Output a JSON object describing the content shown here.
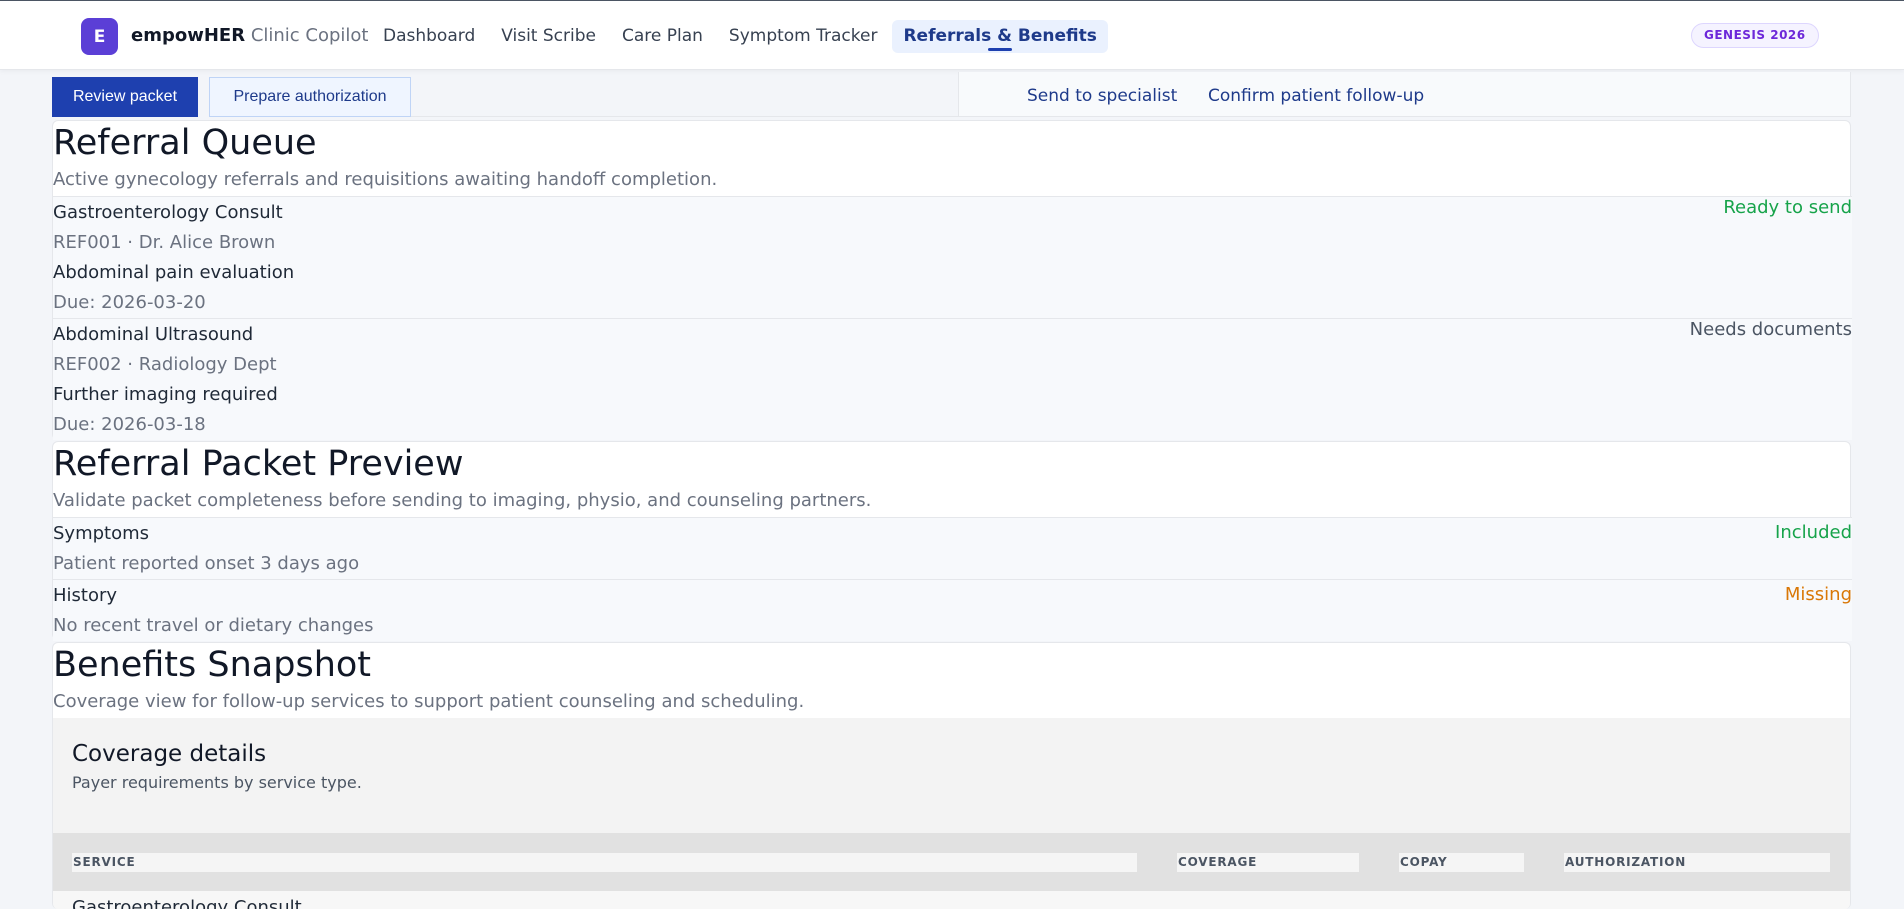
{
  "app": {
    "logo_letter": "E",
    "brand_bold": "empowHER",
    "brand_rest": "Clinic Copilot",
    "badge": "GENESIS 2026"
  },
  "nav": {
    "items": [
      {
        "label": "Dashboard",
        "active": false
      },
      {
        "label": "Visit Scribe",
        "active": false
      },
      {
        "label": "Care Plan",
        "active": false
      },
      {
        "label": "Symptom Tracker",
        "active": false
      },
      {
        "label": "Referrals & Benefits",
        "active": true
      }
    ]
  },
  "actions": {
    "review_packet": "Review packet",
    "prepare_authorization": "Prepare authorization",
    "send_to_specialist": "Send to specialist",
    "confirm_follow_up": "Confirm patient follow-up"
  },
  "referral_queue": {
    "title": "Referral Queue",
    "subtitle": "Active gynecology referrals and requisitions awaiting handoff completion.",
    "items": [
      {
        "name": "Gastroenterology Consult",
        "meta": "REF001 · Dr. Alice Brown",
        "reason": "Abdominal pain evaluation",
        "due": "Due: 2026-03-20",
        "status": "Ready to send",
        "status_color": "#16a34a"
      },
      {
        "name": "Abdominal Ultrasound",
        "meta": "REF002 · Radiology Dept",
        "reason": "Further imaging required",
        "due": "Due: 2026-03-18",
        "status": "Needs documents",
        "status_color": "#4b5563"
      }
    ]
  },
  "packet_preview": {
    "title": "Referral Packet Preview",
    "subtitle": "Validate packet completeness before sending to imaging, physio, and counseling partners.",
    "items": [
      {
        "name": "Symptoms",
        "detail": "Patient reported onset 3 days ago",
        "status": "Included",
        "status_color": "#16a34a"
      },
      {
        "name": "History",
        "detail": "No recent travel or dietary changes",
        "status": "Missing",
        "status_color": "#d97706"
      }
    ]
  },
  "benefits": {
    "title": "Benefits Snapshot",
    "subtitle": "Coverage view for follow-up services to support patient counseling and scheduling.",
    "coverage_title": "Coverage details",
    "coverage_subtitle": "Payer requirements by service type.",
    "columns": [
      "SERVICE",
      "COVERAGE",
      "COPAY",
      "AUTHORIZATION"
    ],
    "rows": [
      {
        "service": "Gastroenterology Consult"
      }
    ]
  }
}
